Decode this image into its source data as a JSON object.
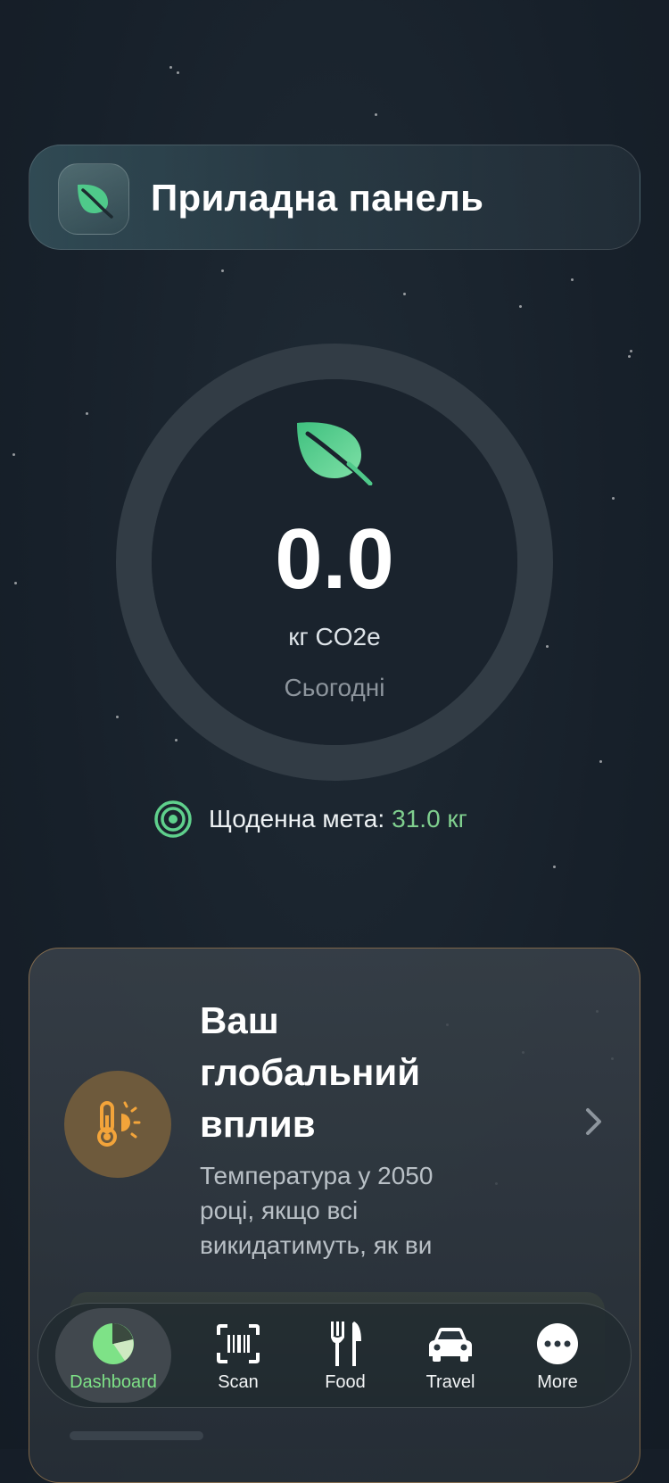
{
  "header": {
    "title": "Приладна панель",
    "icon": "leaf-icon"
  },
  "today": {
    "value": "0.0",
    "unit": "кг CO2e",
    "period": "Сьогодні"
  },
  "goal": {
    "label": "Щоденна мета:",
    "value": "31.0 кг",
    "icon": "target-icon"
  },
  "impact": {
    "title": "Ваш глобальний вплив",
    "subtitle": "Температура у 2050 році, якщо всі викидатимуть, як ви",
    "icon": "thermometer-sun-icon"
  },
  "tabs": [
    {
      "label": "Dashboard",
      "icon": "pie-chart-icon",
      "active": true
    },
    {
      "label": "Scan",
      "icon": "barcode-scan-icon",
      "active": false
    },
    {
      "label": "Food",
      "icon": "fork-knife-icon",
      "active": false
    },
    {
      "label": "Travel",
      "icon": "car-icon",
      "active": false
    },
    {
      "label": "More",
      "icon": "more-icon",
      "active": false
    }
  ],
  "colors": {
    "accent": "#7ee287",
    "goal": "#7fcf8e",
    "impact_border": "#c8965a",
    "leaf": "#4fc98a"
  }
}
